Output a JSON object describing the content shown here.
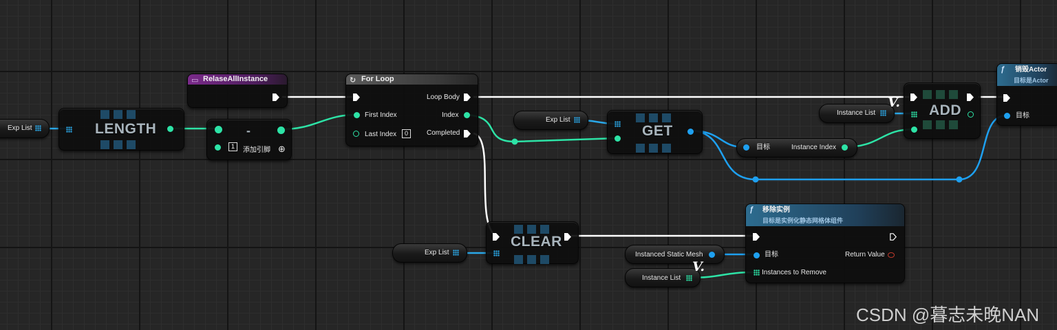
{
  "colors": {
    "exec": "#ffffff",
    "integer": "#2de3a6",
    "object": "#1ea0f0",
    "array": "#2aa8e8",
    "return": "#c0392b",
    "header_function": "#2d6c8f",
    "header_event": "#7a2a8a"
  },
  "nodes": {
    "var_explist_1": {
      "label": "Exp List"
    },
    "length": {
      "label": "LENGTH"
    },
    "subtract": {
      "label": "-",
      "pin_b_value": "1",
      "add_pin": "添加引脚"
    },
    "release": {
      "title": "RelaseAllInstance"
    },
    "forloop": {
      "title": "For Loop",
      "first_index": "First Index",
      "last_index": "Last Index",
      "last_index_value": "0",
      "loop_body": "Loop Body",
      "index": "Index",
      "completed": "Completed"
    },
    "var_explist_2": {
      "label": "Exp List"
    },
    "get": {
      "label": "GET"
    },
    "break_pins": {
      "target": "目标",
      "instance_index": "Instance Index"
    },
    "var_instancelist_1": {
      "label": "Instance List"
    },
    "add": {
      "label": "ADD"
    },
    "destroy_actor": {
      "title": "销毁Actor",
      "subtitle": "目标是Actor",
      "target": "目标"
    },
    "var_explist_3": {
      "label": "Exp List"
    },
    "clear": {
      "label": "CLEAR"
    },
    "remove_instances": {
      "title": "移除实例",
      "subtitle": "目标是实例化静态网格体组件",
      "target": "目标",
      "instances_to_remove": "Instances to Remove",
      "return_value": "Return Value"
    },
    "var_ism": {
      "label": "Instanced Static Mesh"
    },
    "var_instancelist_2": {
      "label": "Instance List"
    }
  },
  "icons": {
    "function_icon": "ƒ",
    "loop_icon": "↻",
    "event_icon": "▭",
    "add_pin_icon": "⊕",
    "var_marker": "V."
  },
  "watermark": "CSDN @暮志未晚NAN"
}
